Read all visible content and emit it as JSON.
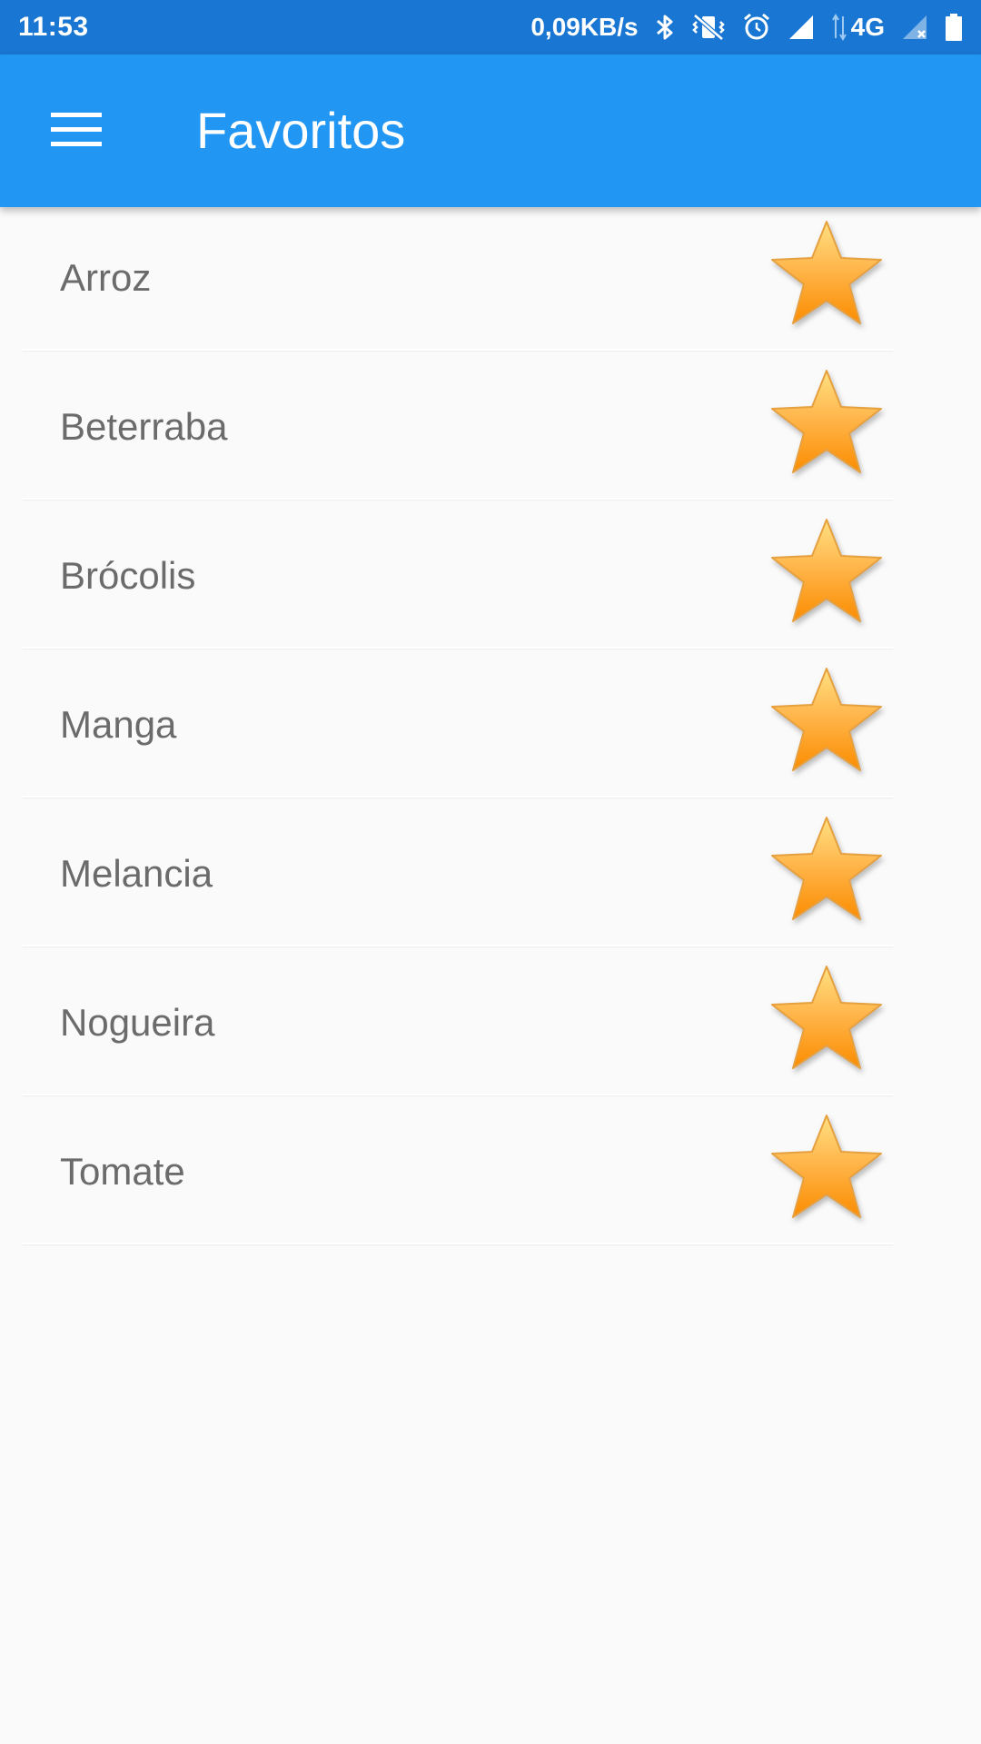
{
  "status_bar": {
    "time": "11:53",
    "net_speed": "0,09KB/s",
    "network_type": "4G",
    "icons": [
      "bluetooth-icon",
      "vibrate-off-icon",
      "alarm-icon",
      "signal-icon",
      "data-arrows-icon",
      "signal-no-service-icon",
      "battery-icon"
    ]
  },
  "app_bar": {
    "title": "Favoritos",
    "menu_icon": "hamburger-menu-icon",
    "color": "#2196f3"
  },
  "favorites": [
    {
      "label": "Arroz",
      "icon": "star-icon"
    },
    {
      "label": "Beterraba",
      "icon": "star-icon"
    },
    {
      "label": "Brócolis",
      "icon": "star-icon"
    },
    {
      "label": "Manga",
      "icon": "star-icon"
    },
    {
      "label": "Melancia",
      "icon": "star-icon"
    },
    {
      "label": "Nogueira",
      "icon": "star-icon"
    },
    {
      "label": "Tomate",
      "icon": "star-icon"
    }
  ],
  "colors": {
    "status_bar": "#1976d2",
    "star_fill": "#ffa726",
    "text": "#6b6b6b"
  }
}
